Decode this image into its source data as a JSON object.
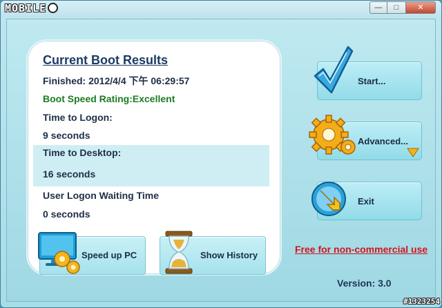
{
  "watermark": "MOBILE",
  "corner_tag": "#1323254",
  "window_controls": {
    "minimize": "—",
    "maximize": "□",
    "close": "✕"
  },
  "results": {
    "title": "Current Boot Results",
    "finished": "Finished: 2012/4/4 下午 06:29:57",
    "rating": "Boot Speed Rating:Excellent",
    "logon_label": "Time to Logon:",
    "logon_value": "9 seconds",
    "desktop_label": "Time to Desktop:",
    "desktop_value": "16 seconds",
    "waiting_label": "User Logon Waiting Time",
    "waiting_value": "0 seconds"
  },
  "buttons": {
    "speed_up": "Speed up PC",
    "history": "Show History",
    "start": "Start...",
    "advanced": "Advanced...",
    "exit": "Exit"
  },
  "footer": {
    "free": "Free for non-commercial use",
    "version": "Version: 3.0"
  },
  "colors": {
    "rating_green": "#1c7a23",
    "free_red": "#d0141f",
    "title_navy": "#1b3b66"
  }
}
